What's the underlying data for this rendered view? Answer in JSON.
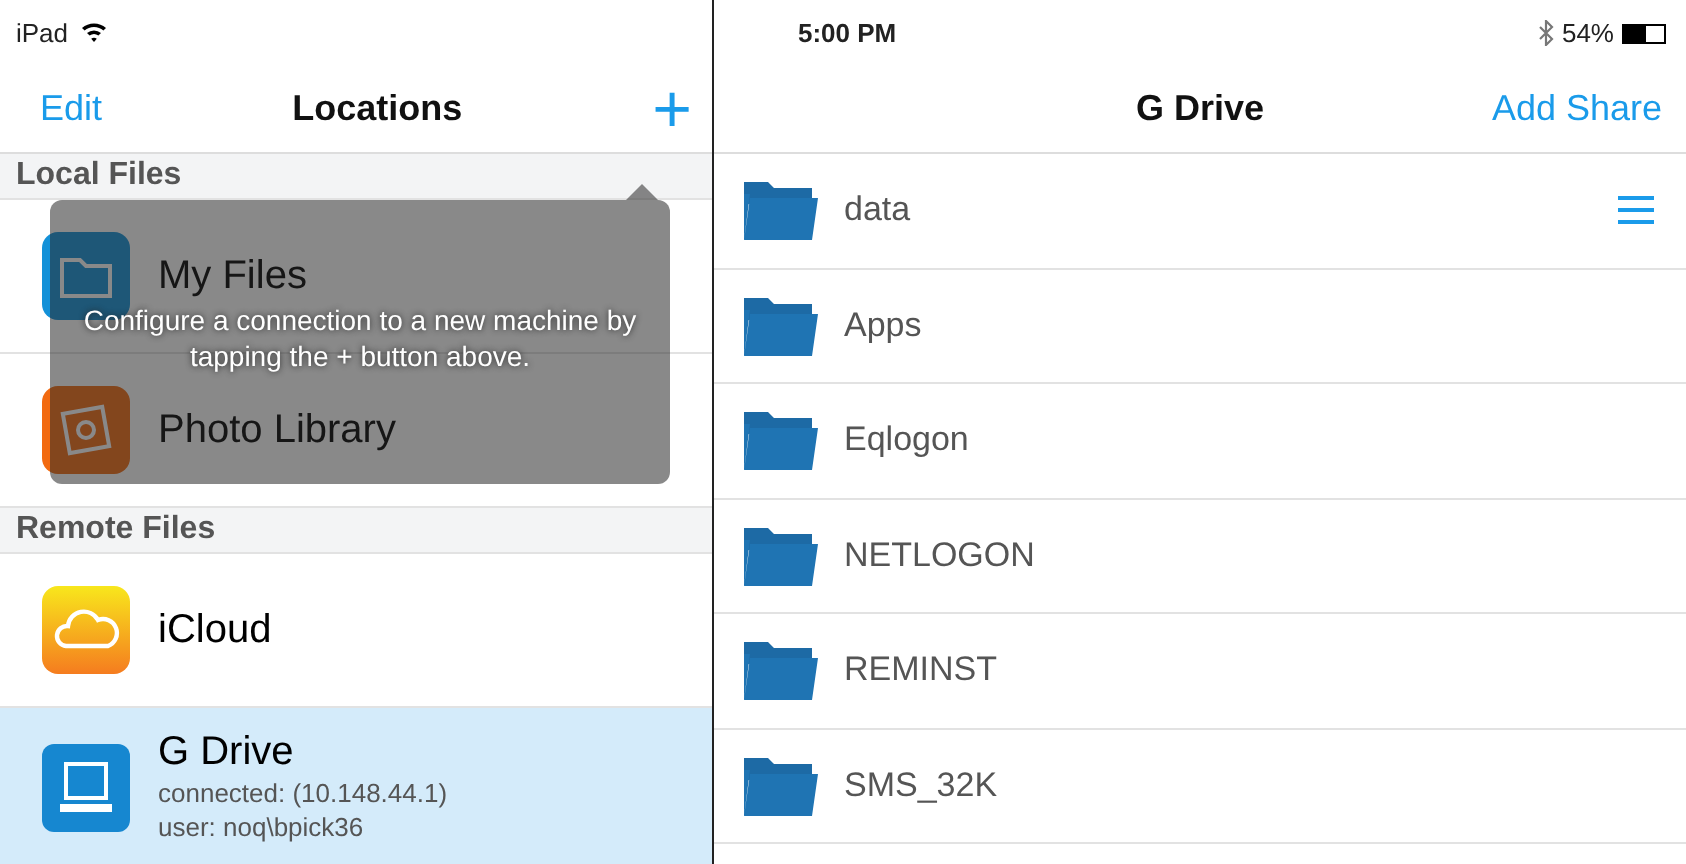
{
  "left": {
    "status_bar": {
      "device": "iPad",
      "wifi": true
    },
    "nav": {
      "edit": "Edit",
      "title": "Locations",
      "add": "+"
    },
    "sections": [
      {
        "header": "Local Files",
        "rows": [
          {
            "kind": "folder",
            "title": "My Files",
            "details": [],
            "selected": false
          },
          {
            "kind": "photos",
            "title": "Photo Library",
            "details": [],
            "selected": false
          }
        ]
      },
      {
        "header": "Remote Files",
        "rows": [
          {
            "kind": "cloud",
            "title": "iCloud",
            "details": [],
            "selected": false
          },
          {
            "kind": "computer",
            "title": "G Drive",
            "details": [
              "connected: (10.148.44.1)",
              "user: noq\\bpick36"
            ],
            "selected": true
          }
        ]
      }
    ],
    "tooltip": "Configure a connection to a new machine by tapping the + button above."
  },
  "right": {
    "status_bar": {
      "time": "5:00 PM",
      "bluetooth": true,
      "battery": "54%"
    },
    "nav": {
      "title": "G Drive",
      "action": "Add Share"
    },
    "folders": [
      {
        "name": "data",
        "menu": true
      },
      {
        "name": "Apps",
        "menu": false
      },
      {
        "name": "Eqlogon",
        "menu": false
      },
      {
        "name": "NETLOGON",
        "menu": false
      },
      {
        "name": "REMINST",
        "menu": false
      },
      {
        "name": "SMS_32K",
        "menu": false
      }
    ]
  }
}
